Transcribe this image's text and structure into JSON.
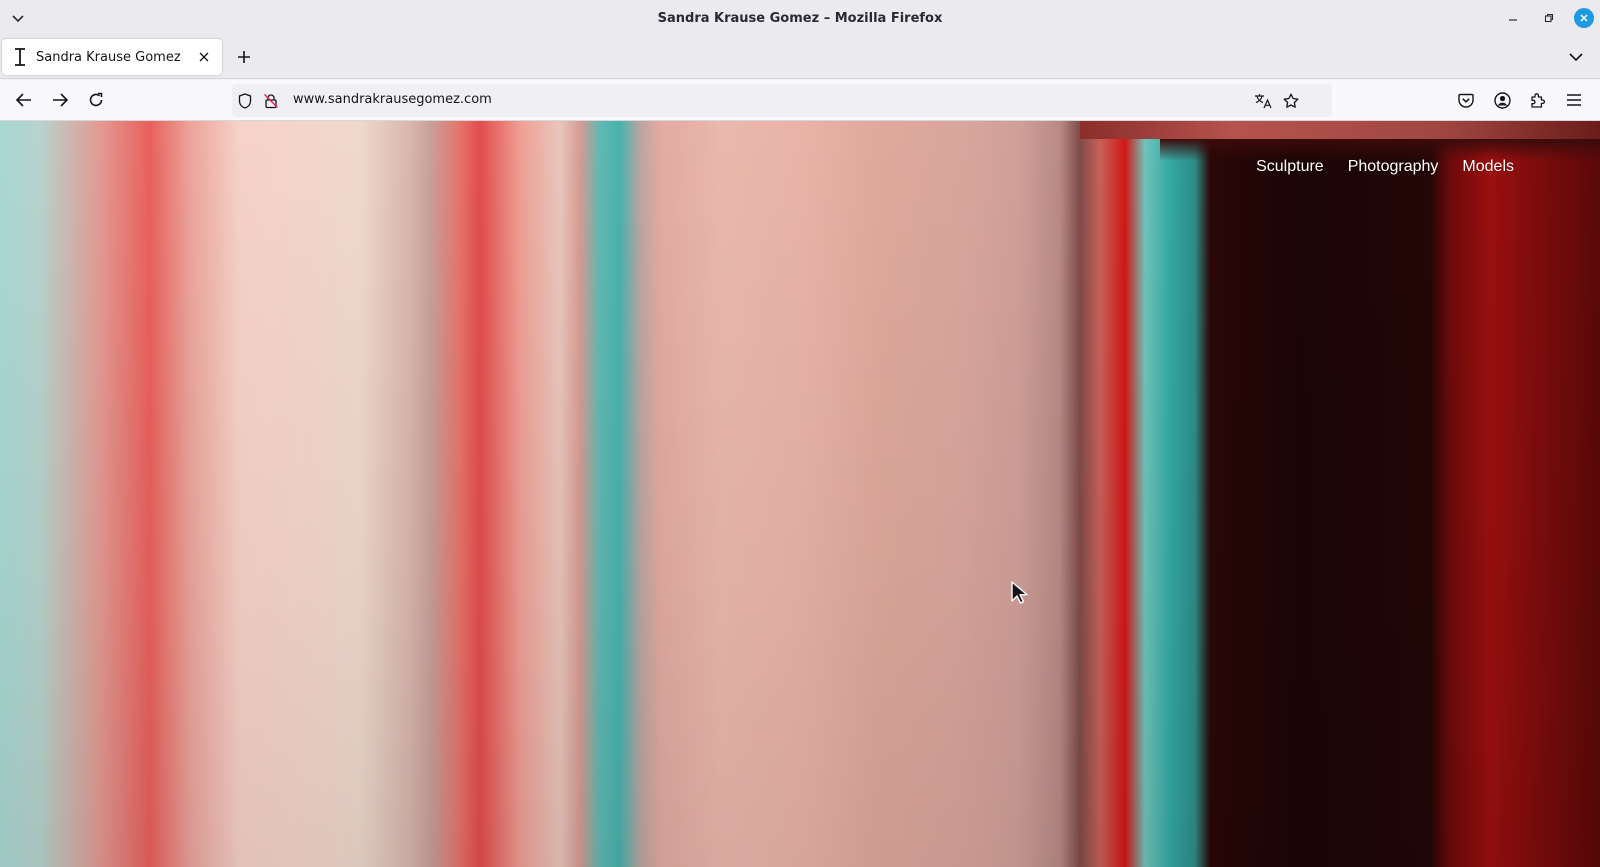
{
  "window": {
    "title": "Sandra Krause Gomez – Mozilla Firefox"
  },
  "tabs": [
    {
      "label": "Sandra Krause Gomez",
      "active": true
    }
  ],
  "navbar": {
    "url": "www.sandrakrausegomez.com"
  },
  "site": {
    "nav": [
      {
        "label": "Sculpture"
      },
      {
        "label": "Photography"
      },
      {
        "label": "Models"
      }
    ]
  },
  "icons": {
    "list_all_tabs": "chevron-down-icon",
    "minimize": "minimize-icon",
    "restore": "restore-icon",
    "close": "close-icon",
    "tab_favicon": "text-cursor-icon",
    "tab_close": "close-icon",
    "new_tab": "plus-icon",
    "back": "back-arrow-icon",
    "forward": "forward-arrow-icon",
    "reload": "reload-icon",
    "tracking": "shield-icon",
    "insecure": "lock-icon",
    "translate": "translate-icon",
    "bookmark": "star-icon",
    "pocket": "pocket-icon",
    "account": "account-icon",
    "extensions": "puzzle-icon",
    "menu": "hamburger-icon"
  },
  "colors": {
    "accent_close": "#1e9ae0",
    "chrome_bg": "#ebebef",
    "site_nav_text": "#ffffff"
  }
}
